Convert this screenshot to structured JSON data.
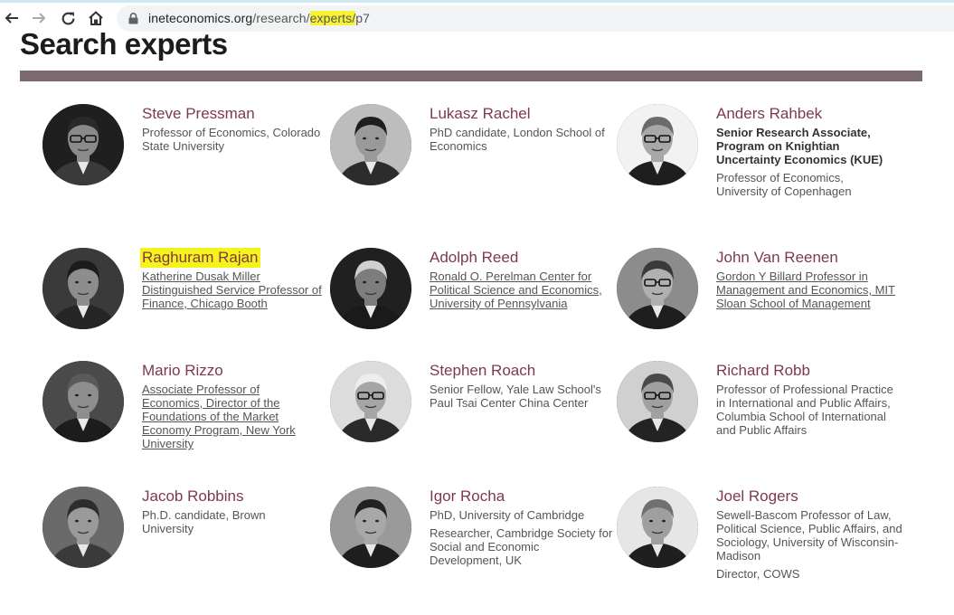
{
  "browser": {
    "url_host": "ineteconomics.org",
    "url_path_1": "/research/",
    "url_path_hl": "experts/",
    "url_path_2": "p7"
  },
  "page": {
    "title_plain": "Search",
    "title_highlight": "experts"
  },
  "experts": [
    {
      "name": "Steve Pressman",
      "lines": [
        {
          "text": "Professor of Economics, Colorado State University",
          "style": "plain"
        }
      ]
    },
    {
      "name": "Lukasz Rachel",
      "lines": [
        {
          "text": "PhD candidate, London School of Economics",
          "style": "plain"
        }
      ]
    },
    {
      "name": "Anders Rahbek",
      "lines": [
        {
          "text": "Senior Research Associate, Program on Knightian Uncertainty Economics (KUE)",
          "style": "bold"
        },
        {
          "text": "Professor of Economics, University of Copenhagen",
          "style": "plain"
        }
      ]
    },
    {
      "name": "Raghuram Rajan",
      "lines": [
        {
          "text": "Katherine Dusak Miller Distinguished Service Professor of Finance, Chicago Booth",
          "style": "link"
        }
      ]
    },
    {
      "name": "Adolph Reed",
      "lines": [
        {
          "text": "Ronald O. Perelman Center for Political Science and Economics, University of Pennsylvania",
          "style": "link"
        }
      ]
    },
    {
      "name": "John Van Reenen",
      "lines": [
        {
          "text": "Gordon Y Billard Professor in Management and Economics, MIT Sloan School of Management",
          "style": "link"
        }
      ]
    },
    {
      "name": "Mario Rizzo",
      "lines": [
        {
          "text": "Associate Professor of Economics, Director of the Foundations of the Market Economy Program, New York University",
          "style": "link"
        }
      ]
    },
    {
      "name": "Stephen Roach",
      "lines": [
        {
          "text": "Senior Fellow, Yale Law School's Paul Tsai Center China Center",
          "style": "plain"
        }
      ]
    },
    {
      "name": "Richard Robb",
      "lines": [
        {
          "text": "Professor of Professional Practice in International and Public Affairs, Columbia School of International and Public Affairs",
          "style": "plain"
        }
      ]
    },
    {
      "name": "Jacob Robbins",
      "lines": [
        {
          "text": "Ph.D. candidate, Brown University",
          "style": "plain"
        }
      ]
    },
    {
      "name": "Igor Rocha",
      "lines": [
        {
          "text": "PhD, University of Cambridge",
          "style": "plain"
        },
        {
          "text": "Researcher, Cambridge Society for Social and Economic Development, UK",
          "style": "plain"
        }
      ]
    },
    {
      "name": "Joel Rogers",
      "lines": [
        {
          "text": "Sewell-Bascom Professor of Law, Political Science, Public Affairs, and Sociology, University of Wisconsin-Madison",
          "style": "plain"
        },
        {
          "text": "Director, COWS",
          "style": "plain"
        }
      ]
    }
  ],
  "colors": {
    "name": "#7d3a4b",
    "rule": "#7b6a70",
    "highlight": "#f6f31b"
  }
}
